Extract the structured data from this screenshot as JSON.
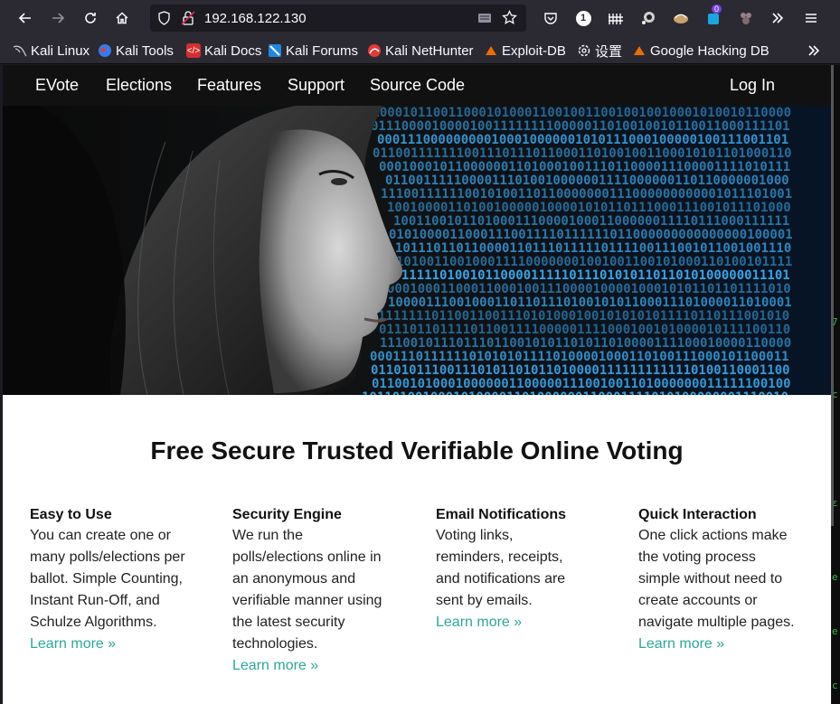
{
  "browser": {
    "url": "192.168.122.130",
    "notification_count": "1",
    "extension_badge": "0"
  },
  "bookmarks": [
    {
      "label": "Kali Linux",
      "icon": "kali-dragon-icon",
      "color": "#367bf0"
    },
    {
      "label": "Kali Tools",
      "icon": "kali-tools-icon",
      "color": "#367bf0"
    },
    {
      "label": "Kali Docs",
      "icon": "kali-docs-icon",
      "color": "#d32f2f"
    },
    {
      "label": "Kali Forums",
      "icon": "kali-forums-icon",
      "color": "#1e88e5"
    },
    {
      "label": "Kali NetHunter",
      "icon": "kali-nethunter-icon",
      "color": "#e53935"
    },
    {
      "label": "Exploit-DB",
      "icon": "exploit-db-icon",
      "color": "#ef6c00"
    },
    {
      "label": "设置",
      "icon": "gear-icon",
      "color": "#fbfbfe"
    },
    {
      "label": "Google Hacking DB",
      "icon": "ghdb-icon",
      "color": "#ef6c00"
    }
  ],
  "site": {
    "nav": {
      "brand": "EVote",
      "elections": "Elections",
      "features": "Features",
      "support": "Support",
      "source_code": "Source Code",
      "login": "Log In"
    },
    "headline": "Free Secure Trusted Verifiable Online Voting",
    "features": [
      {
        "title": "Easy to Use",
        "body": "You can create one or many polls/elections per ballot. Simple Counting, Instant Run-Off, and Schulze Algorithms.",
        "link": "Learn more »"
      },
      {
        "title": "Security Engine",
        "body": "We run the polls/elections online in an anonymous and verifiable manner using the latest security technologies.",
        "link": "Learn more »"
      },
      {
        "title": "Email Notifications",
        "body": "Voting links, reminders, receipts, and notifications are sent by emails.",
        "link": "Learn more »"
      },
      {
        "title": "Quick Interaction",
        "body": "One click actions make the voting process simple without need to create accounts or navigate multiple pages.",
        "link": "Learn more »"
      }
    ]
  },
  "colors": {
    "accent_link": "#2aa89c",
    "binary_blue": "#3aa6e8",
    "nav_bg": "#111111"
  }
}
